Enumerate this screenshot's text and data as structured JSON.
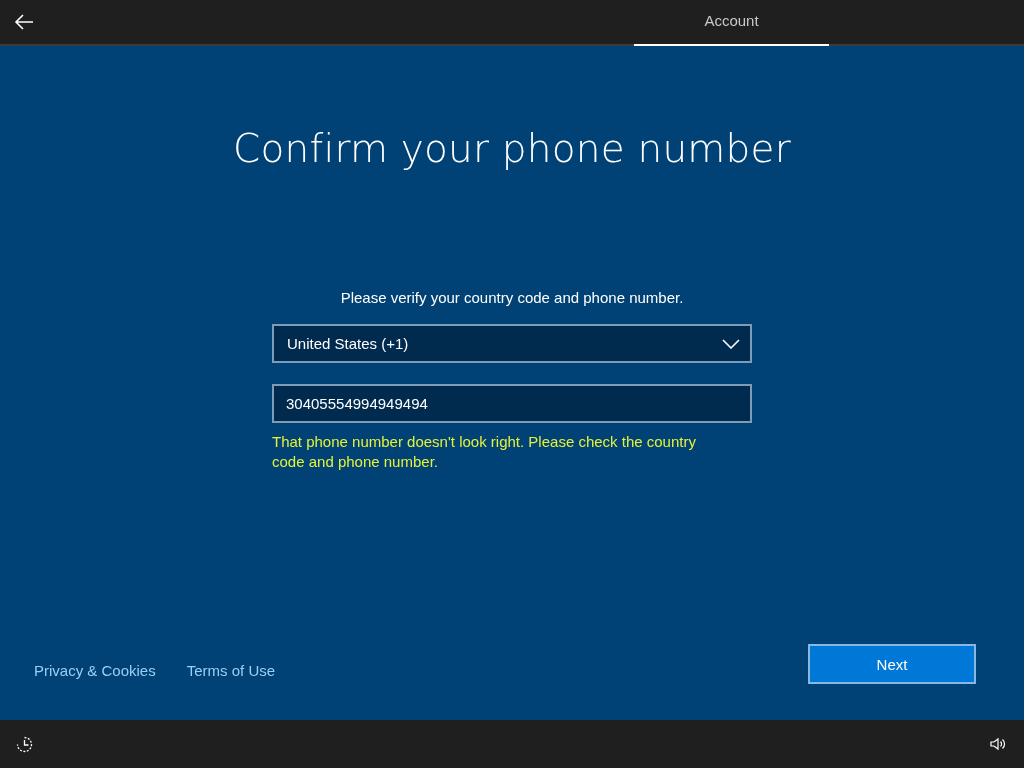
{
  "top_bar": {
    "tabs": [
      {
        "label": "Account",
        "selected": true
      }
    ]
  },
  "title": "Confirm your phone number",
  "instructions": "Please verify your country code and phone number.",
  "country_select": {
    "value": "United States (+1)"
  },
  "phone_field": {
    "value": "30405554994949494"
  },
  "error_message": "That phone number doesn't look right. Please check the country code and phone number.",
  "footer_links": [
    "Privacy & Cookies",
    "Terms of Use"
  ],
  "buttons": [
    "Next"
  ]
}
